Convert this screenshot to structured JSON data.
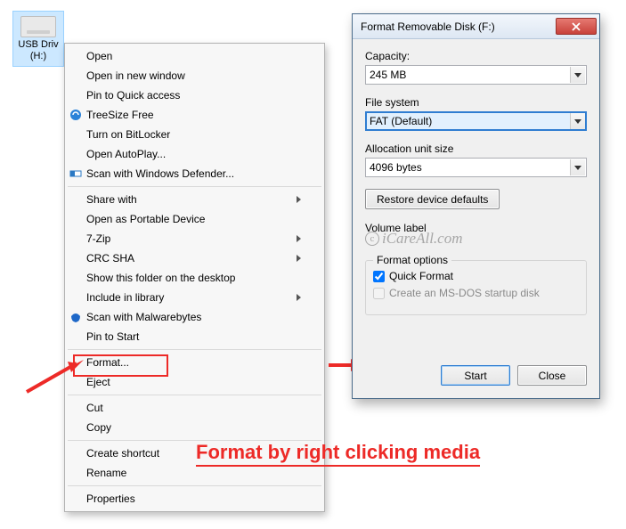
{
  "drive": {
    "label1": "USB Driv",
    "label2": "(H:)"
  },
  "menu": {
    "open": "Open",
    "open_new_window": "Open in new window",
    "pin_quick": "Pin to Quick access",
    "treesize": "TreeSize Free",
    "bitlocker": "Turn on BitLocker",
    "autoplay": "Open AutoPlay...",
    "defender": "Scan with Windows Defender...",
    "share_with": "Share with",
    "portable": "Open as Portable Device",
    "sevenzip": "7-Zip",
    "crc": "CRC SHA",
    "show_desktop": "Show this folder on the desktop",
    "include_lib": "Include in library",
    "malwarebytes": "Scan with Malwarebytes",
    "pin_start": "Pin to Start",
    "format": "Format...",
    "eject": "Eject",
    "cut": "Cut",
    "copy": "Copy",
    "shortcut": "Create shortcut",
    "rename": "Rename",
    "properties": "Properties"
  },
  "dialog": {
    "title": "Format Removable Disk (F:)",
    "capacity_label": "Capacity:",
    "capacity_value": "245 MB",
    "fs_label": "File system",
    "fs_value": "FAT (Default)",
    "alloc_label": "Allocation unit size",
    "alloc_value": "4096 bytes",
    "restore_btn": "Restore device defaults",
    "vol_label": "Volume label",
    "watermark": "iCareAll.com",
    "group_title": "Format options",
    "quick_format": "Quick Format",
    "msdos": "Create an MS-DOS startup disk",
    "start_btn": "Start",
    "close_btn": "Close"
  },
  "caption": "Format by right clicking media"
}
